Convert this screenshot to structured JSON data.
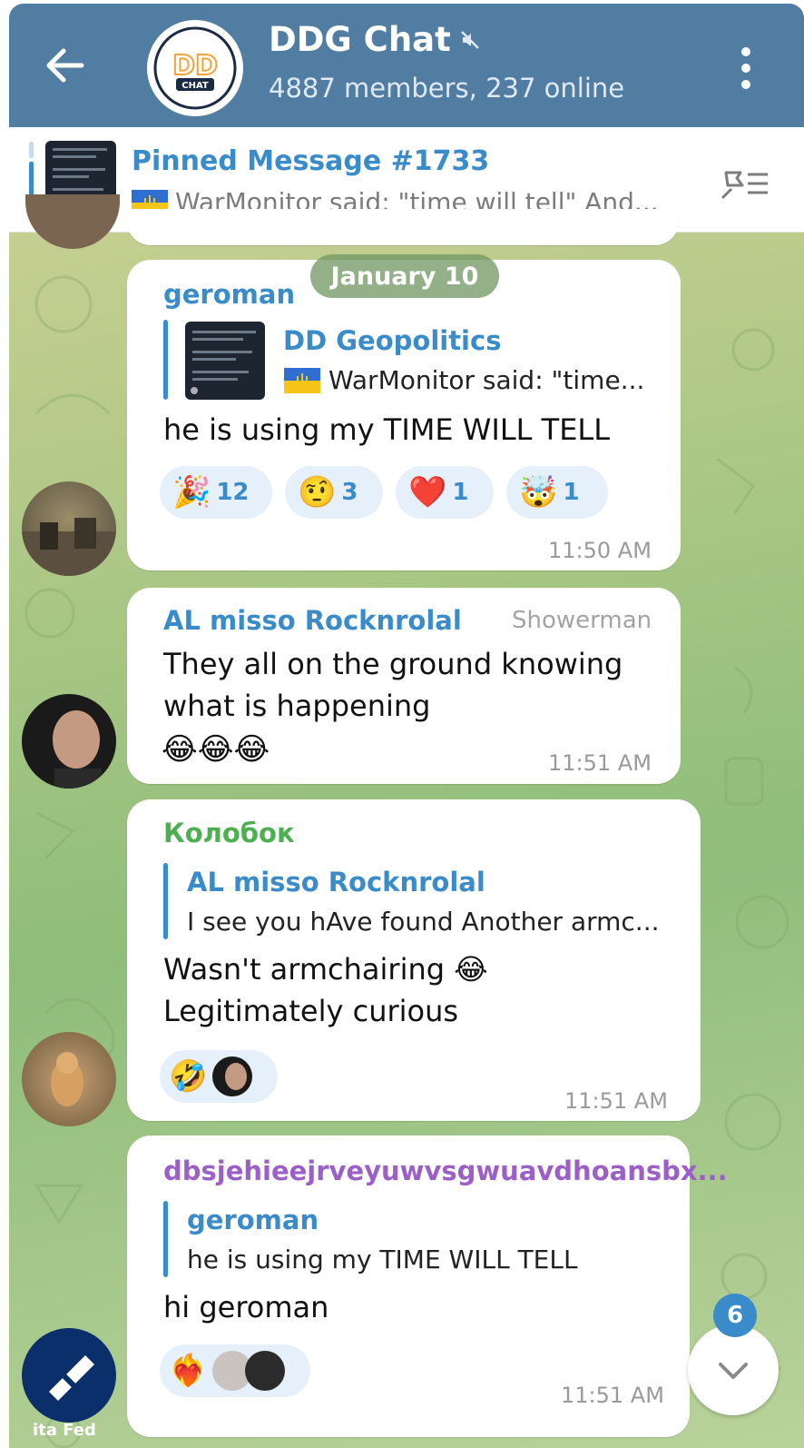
{
  "header": {
    "title": "DDG Chat",
    "subtitle": "4887 members, 237 online",
    "avatar_label_top": "DD",
    "avatar_label_bottom": "CHAT",
    "accent": "#517da2"
  },
  "pinned": {
    "title": "Pinned Message #1733",
    "text": "WarMonitor said: \"time will tell\"  And..."
  },
  "date_separator": "January 10",
  "messages": [
    {
      "sender": "geroman",
      "sender_color": "#3a8bc9",
      "reply_author": "DD Geopolitics",
      "reply_text": "WarMonitor said: \"time...",
      "text": "he is using my TIME WILL TELL",
      "reactions": [
        {
          "emoji": "🎉",
          "count": "12"
        },
        {
          "emoji": "🤨",
          "count": "3"
        },
        {
          "emoji": "❤️",
          "count": "1"
        },
        {
          "emoji": "🤯",
          "count": "1"
        }
      ],
      "time": "11:50 AM"
    },
    {
      "sender": "AL misso Rocknrolal",
      "sender_color": "#3a8bc9",
      "admin_title": "Showerman",
      "text_line1": "They all on the ground knowing",
      "text_line2": "what is happening",
      "emoji_line": "😂😂😂",
      "time": "11:51 AM"
    },
    {
      "sender": "Колобок",
      "sender_color": "#4caf50",
      "reply_author": "AL misso Rocknrolal",
      "reply_text": "I see you hAve found Another armc...",
      "text_line1": "Wasn't armchairing 😂",
      "text_line2": "Legitimately curious",
      "reactions": [
        {
          "emoji": "🤣"
        }
      ],
      "time": "11:51 AM"
    },
    {
      "sender": "dbsjehieejrveyuwvsgwuavdhoansbx...",
      "sender_color": "#9c5fc7",
      "reply_author": "geroman",
      "reply_text": "he is using my TIME WILL TELL",
      "text": "hi geroman",
      "reactions": [
        {
          "emoji": "❤️‍🔥"
        }
      ],
      "time": "11:51 AM"
    }
  ],
  "avatar_bottom_label": "ita Fed",
  "scroll_badge": "6"
}
